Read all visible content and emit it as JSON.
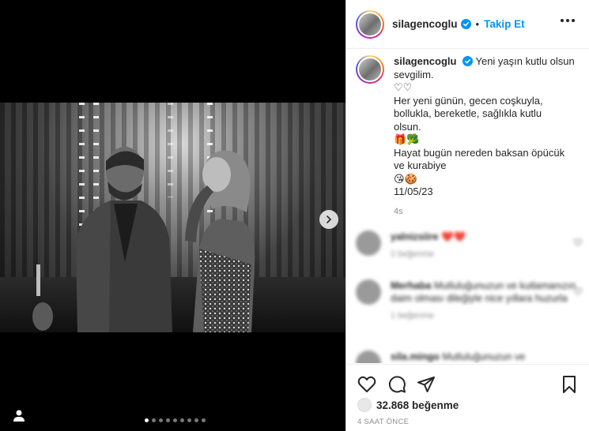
{
  "post": {
    "username": "silagencoglu",
    "separator": "•",
    "follow_label": "Takip Et",
    "caption": {
      "username": "silagencoglu",
      "line1": "Yeni yaşın kutlu olsun",
      "line2": "sevgilim.",
      "line3": "♡♡",
      "line4": "Her yeni günün, gecen coşkuyla,",
      "line5": "bollukla, bereketle, sağlıkla kutlu",
      "line6": "olsun.",
      "line7": "🎁🥦",
      "line8": "Hayat bugün nereden baksan öpücük",
      "line9": "ve kurabiye",
      "line10": "😘🍪",
      "line11": "11/05/23"
    },
    "caption_time": "4s",
    "likes_count": "32.868 beğenme",
    "posted_ago": "4 SAAT ÖNCE"
  },
  "comments": [
    {
      "user": "yalnizsiire",
      "text": "❤️❤️",
      "meta": "2 beğenme"
    },
    {
      "user": "Merhaba",
      "text": "Mutluluğunuzun ve kutlamanızın daim olması dileğiyle nice yıllara huzurla",
      "meta": "1 beğenme"
    },
    {
      "user": "sila.mingo",
      "text": "Mutluluğunuzun ve",
      "meta": ""
    }
  ],
  "carousel": {
    "total": 9,
    "active_index": 0
  },
  "colors": {
    "accent": "#0095f6",
    "verified": "#0095f6",
    "text": "#262626",
    "muted": "#8e8e8e"
  },
  "icons": [
    "verified-badge-icon",
    "more-options-icon",
    "next-arrow-icon",
    "heart-icon",
    "comment-icon",
    "share-icon",
    "bookmark-icon",
    "tag-user-icon"
  ]
}
